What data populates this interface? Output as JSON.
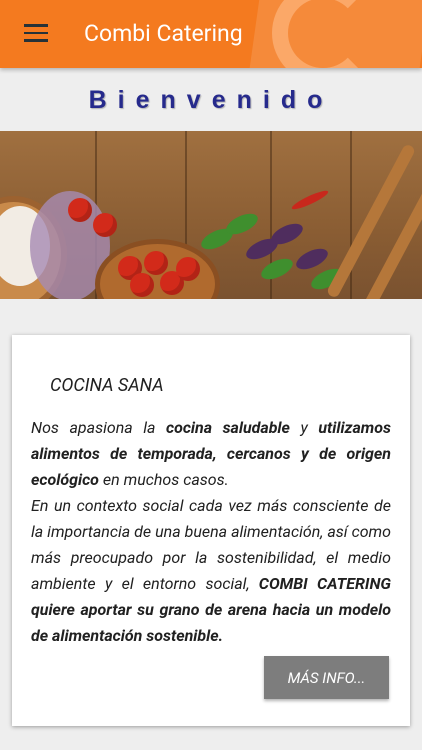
{
  "app_bar": {
    "title": "Combi Catering",
    "menu_icon": "hamburger-menu-icon",
    "color": "#f47a1f"
  },
  "welcome": {
    "text": "Bienvenido",
    "color": "#262a8c"
  },
  "banner": {
    "image": "cooking-ingredients-on-wood"
  },
  "card": {
    "title": "COCINA SANA",
    "paragraph1": {
      "t1": "Nos apasiona la ",
      "b1": "cocina saludable",
      "t2": " y ",
      "b2": "utilizamos alimentos de temporada, cercanos y de origen ecológico",
      "t3": " en muchos casos."
    },
    "paragraph2": {
      "t1": "En un contexto social cada vez más consciente de la importancia de una buena alimentación, así como más preocupado por la sostenibilidad, el medio ambiente y el entorno social, ",
      "b1": "COMBI CATERING quiere aportar su grano de arena hacia un modelo de alimentación sostenible."
    },
    "button_label": "MÁS INFO..."
  }
}
